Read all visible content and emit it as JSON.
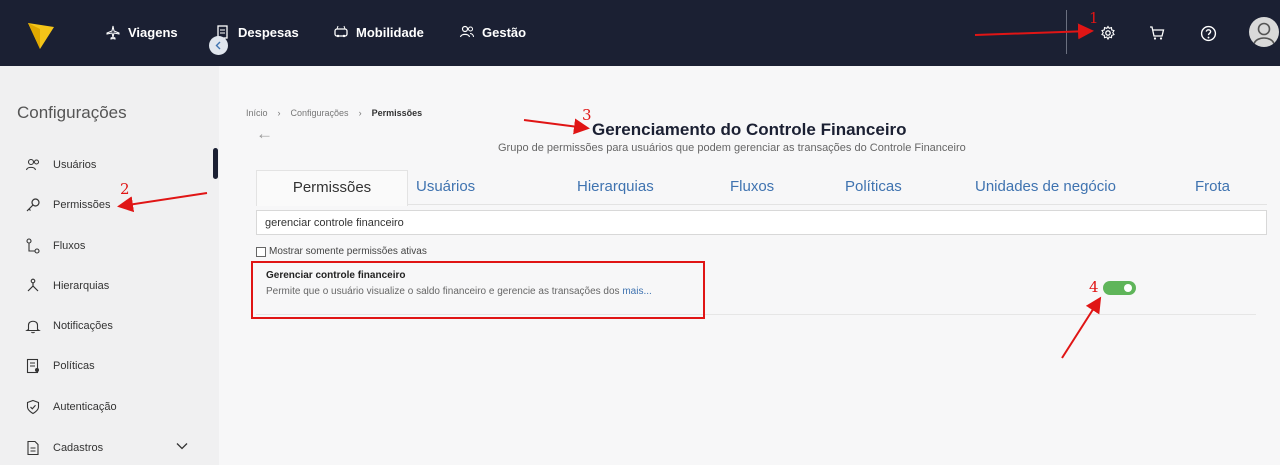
{
  "topbar": {
    "nav": [
      {
        "label": "Viagens",
        "icon": "plane-icon"
      },
      {
        "label": "Despesas",
        "icon": "receipt-icon"
      },
      {
        "label": "Mobilidade",
        "icon": "car-icon"
      },
      {
        "label": "Gestão",
        "icon": "users-icon"
      }
    ],
    "icons": [
      "gear-icon",
      "cart-icon",
      "help-icon",
      "user-avatar-icon"
    ]
  },
  "sidebar": {
    "title": "Configurações",
    "items": [
      {
        "label": "Usuários",
        "icon": "users-icon"
      },
      {
        "label": "Permissões",
        "icon": "key-icon"
      },
      {
        "label": "Fluxos",
        "icon": "flow-icon"
      },
      {
        "label": "Hierarquias",
        "icon": "hierarchy-icon"
      },
      {
        "label": "Notificações",
        "icon": "bell-icon"
      },
      {
        "label": "Políticas",
        "icon": "policy-icon"
      },
      {
        "label": "Autenticação",
        "icon": "shield-icon"
      },
      {
        "label": "Cadastros",
        "icon": "document-icon"
      }
    ]
  },
  "breadcrumb": [
    "Início",
    "Configurações",
    "Permissões"
  ],
  "page": {
    "title": "Gerenciamento do Controle Financeiro",
    "subtitle": "Grupo de permissões para usuários que podem gerenciar as transações do Controle Financeiro"
  },
  "tabs": [
    "Permissões",
    "Usuários",
    "Hierarquias",
    "Fluxos",
    "Políticas",
    "Unidades de negócio",
    "Frota"
  ],
  "search": {
    "value": "gerenciar controle financeiro"
  },
  "filter": {
    "label": "Mostrar somente permissões ativas",
    "checked": false
  },
  "permission": {
    "title": "Gerenciar controle financeiro",
    "description": "Permite que o usuário visualize o saldo financeiro e gerencie as transações dos",
    "more": "mais...",
    "enabled": true
  },
  "annotations": [
    "1",
    "2",
    "3",
    "4"
  ],
  "colors": {
    "topbar": "#1b2033",
    "accent_tab": "#3f73b0",
    "toggle_on": "#5fb55a",
    "annotation": "#e01515",
    "logo": "#f5c518"
  }
}
